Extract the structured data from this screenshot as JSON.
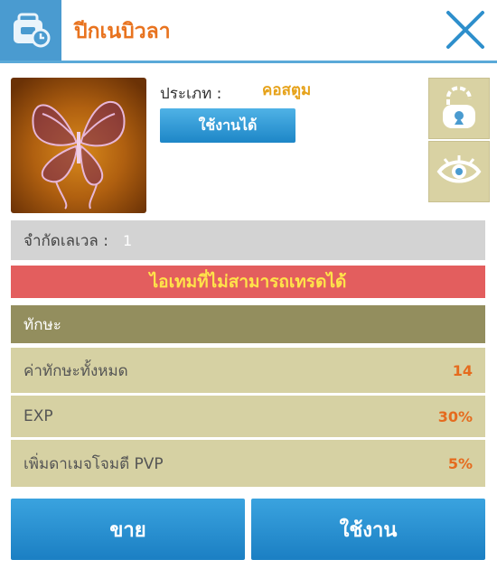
{
  "header": {
    "title": "ปีกเนบิวลา",
    "icon": "backpack-clock-icon",
    "close_icon": "close-icon",
    "accent": "#4a9bd0"
  },
  "item": {
    "type_label": "ประเภท :",
    "type_value": "คอสตูม",
    "usable_label": "ใช้งานได้",
    "image_icon": "butterfly-wings-icon"
  },
  "side_buttons": {
    "lock": "unlock-icon",
    "view": "eye-icon"
  },
  "level": {
    "label": "จำกัดเลเวล :",
    "value": "1"
  },
  "trade_status": "ไอเทมที่ไม่สามารถเทรดได้",
  "skills": {
    "header": "ทักษะ",
    "rows": [
      {
        "label": "ค่าทักษะทั้งหมด",
        "value": "14"
      },
      {
        "label": "EXP",
        "value": "30%"
      },
      {
        "label": "เพิ่มดาเมจโจมตี PVP",
        "value": "5%"
      }
    ]
  },
  "buttons": {
    "sell": "ขาย",
    "use": "ใช้งาน"
  }
}
